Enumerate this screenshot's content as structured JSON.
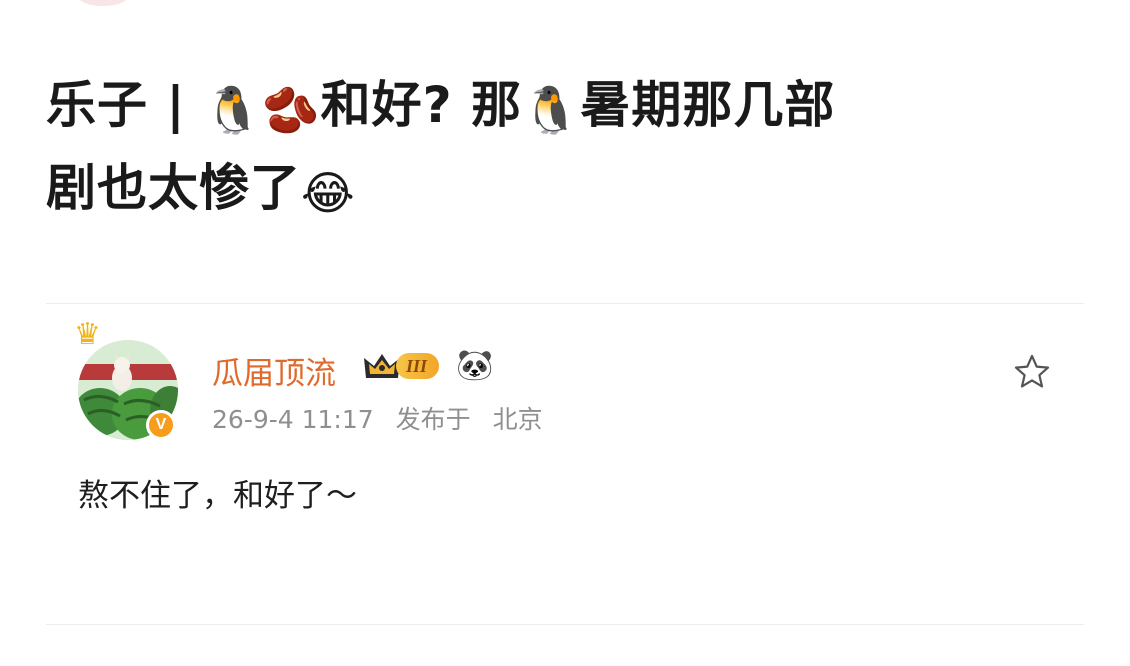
{
  "post": {
    "title_line1_part1": "乐子 | ",
    "title_icon1": "🐧",
    "title_icon2": "🫘",
    "title_line1_part2": "和好? 那",
    "title_icon3": "🐧",
    "title_line1_part3": "暑期那几部",
    "title_line2": "剧也太惨了",
    "title_icon4": "😂"
  },
  "comment": {
    "user_name": "瓜届顶流",
    "rank_badge": "III",
    "panda_icon": "🐼",
    "crown_icon": "crown-icon",
    "verified_badge": "V",
    "timestamp": "26-9-4 11:17",
    "location_prefix": "发布于",
    "location": "北京",
    "text": "熬不住了，和好了～",
    "star_icon": "star-outline-icon"
  },
  "colors": {
    "username": "#e06a2c",
    "meta": "#8f8f8f",
    "badge_orange": "#f79c1b",
    "divider": "#ececec"
  }
}
